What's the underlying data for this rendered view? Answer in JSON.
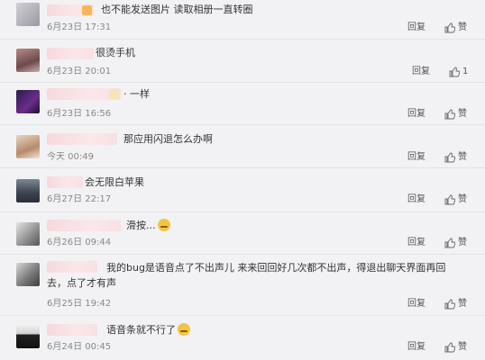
{
  "comments": [
    {
      "text": "也不能发送图片 读取相册一直转圈",
      "time": "6月23日 17:31",
      "reply": "回复",
      "like": "赞"
    },
    {
      "text": "很烫手机",
      "time": "6月23日 20:01",
      "reply": "回复",
      "like": "1"
    },
    {
      "text": "· 一样",
      "time": "6月23日 16:56",
      "reply": "回复",
      "like": "赞"
    },
    {
      "text": "那应用闪退怎么办啊",
      "time": "今天 00:49",
      "reply": "回复",
      "like": "赞"
    },
    {
      "text": "会无限白苹果",
      "time": "6月27日 22:17",
      "reply": "回复",
      "like": "赞"
    },
    {
      "text": "滑按...",
      "time": "6月26日 09:44",
      "reply": "回复",
      "like": "赞"
    },
    {
      "text": "我的bug是语音点了不出声儿 来来回回好几次都不出声，得退出聊天界面再回去，点了才有声",
      "time": "6月25日 19:42",
      "reply": "回复",
      "like": "赞"
    },
    {
      "text": "语音条就不行了",
      "time": "6月24日 00:45",
      "reply": "回复",
      "like": "赞"
    }
  ],
  "icons": {
    "like": "thumbs-up-icon",
    "emoji": "smiley-emoji-icon"
  },
  "colors": {
    "background": "#f2f2f5",
    "name_blur": "#f6d9dd",
    "time": "#888888",
    "reply": "#555555"
  }
}
